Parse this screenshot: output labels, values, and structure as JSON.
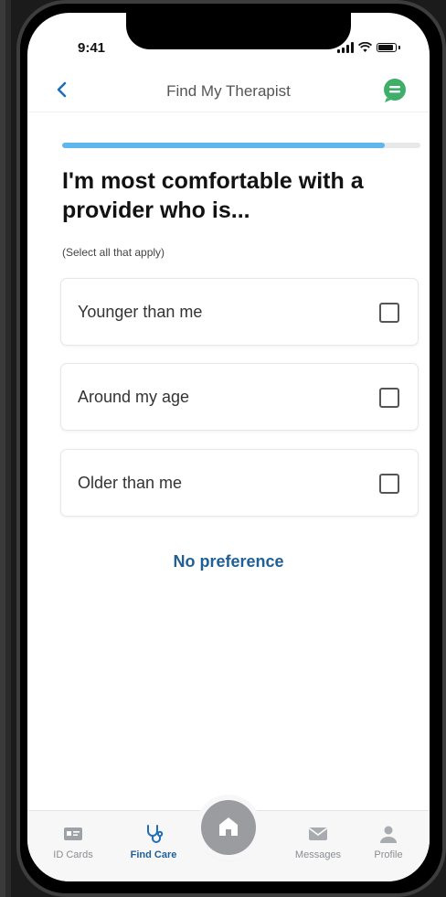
{
  "status_bar": {
    "time": "9:41"
  },
  "header": {
    "title": "Find My Therapist"
  },
  "progress": {
    "value": 0.9
  },
  "question": {
    "title": "I'm most comfortable with a provider who is...",
    "hint": "(Select all that apply)"
  },
  "options": [
    {
      "label": "Younger than me",
      "checked": false
    },
    {
      "label": "Around my age",
      "checked": false
    },
    {
      "label": "Older than me",
      "checked": false
    }
  ],
  "no_preference": "No preference",
  "tabbar": {
    "id_cards": "ID Cards",
    "find_care": "Find Care",
    "messages": "Messages",
    "profile": "Profile"
  },
  "colors": {
    "accent": "#1f5f96",
    "progress": "#5fb6ec",
    "chat": "#3fae6b"
  }
}
